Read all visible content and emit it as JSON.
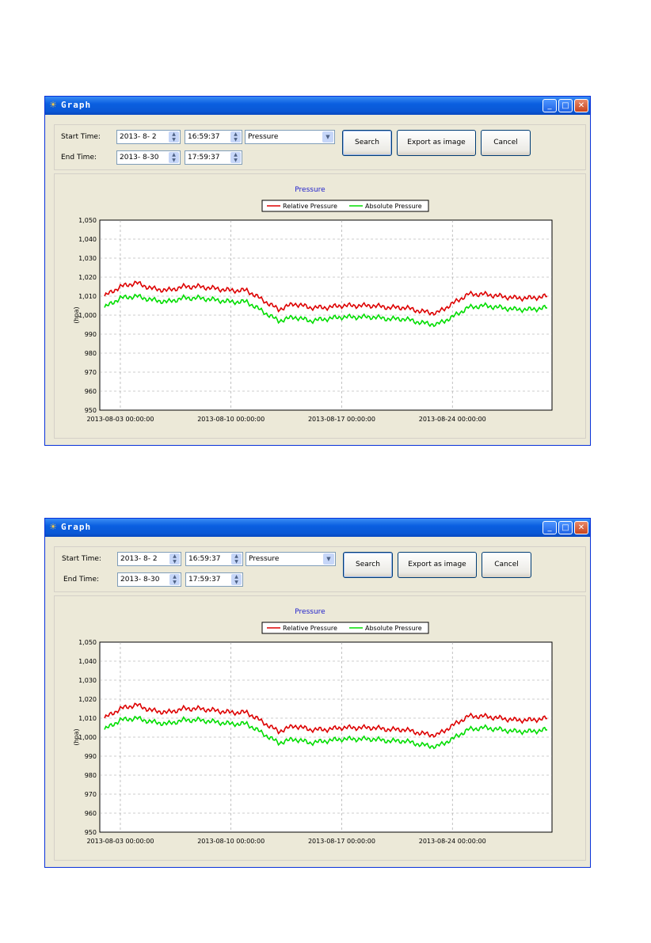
{
  "windows": [
    {
      "title": "Graph",
      "start_label": "Start Time:",
      "end_label": "End Time:",
      "start_date": "2013- 8- 2",
      "start_time": "16:59:37",
      "end_date": "2013- 8-30",
      "end_time": "17:59:37",
      "type_selected": "Pressure",
      "search_label": "Search",
      "export_label": "Export as image",
      "cancel_label": "Cancel"
    },
    {
      "title": "Graph",
      "start_label": "Start Time:",
      "end_label": "End Time:",
      "start_date": "2013- 8- 2",
      "start_time": "16:59:37",
      "end_date": "2013- 8-30",
      "end_time": "17:59:37",
      "type_selected": "Pressure",
      "search_label": "Search",
      "export_label": "Export as image",
      "cancel_label": "Cancel"
    }
  ],
  "colors": {
    "relative": "#dd0000",
    "absolute": "#00dd00",
    "title_text": "#2222cc"
  },
  "chart_data": [
    {
      "type": "line",
      "title": "Pressure",
      "ylabel": "(hpa)",
      "ylim": [
        950,
        1050
      ],
      "yticks": [
        "950",
        "960",
        "970",
        "980",
        "990",
        "1,000",
        "1,010",
        "1,020",
        "1,030",
        "1,040",
        "1,050"
      ],
      "x_tick_labels": [
        "2013-08-03 00:00:00",
        "2013-08-10 00:00:00",
        "2013-08-17 00:00:00",
        "2013-08-24 00:00:00"
      ],
      "x_days": [
        0,
        1,
        2,
        3,
        4,
        5,
        6,
        7,
        8,
        9,
        10,
        11,
        12,
        13,
        14,
        15,
        16,
        17,
        18,
        19,
        20,
        21,
        22,
        23,
        24,
        25,
        26,
        27,
        28
      ],
      "x_start": "2013-08-02",
      "grid": true,
      "legend_position": "top",
      "series": [
        {
          "name": "Relative Pressure",
          "values": [
            1010,
            1015,
            1017,
            1014,
            1013,
            1015,
            1015,
            1014,
            1013,
            1013,
            1008,
            1003,
            1006,
            1004,
            1004,
            1005,
            1005,
            1005,
            1004,
            1004,
            1002,
            1001,
            1006,
            1011,
            1011,
            1010,
            1009,
            1009,
            1010
          ]
        },
        {
          "name": "Absolute Pressure",
          "values": [
            1004,
            1009,
            1010,
            1008,
            1007,
            1009,
            1009,
            1008,
            1007,
            1007,
            1002,
            997,
            999,
            997,
            998,
            999,
            999,
            999,
            998,
            998,
            996,
            995,
            999,
            1004,
            1005,
            1004,
            1003,
            1003,
            1004
          ]
        }
      ]
    },
    {
      "type": "line",
      "title": "Pressure",
      "ylabel": "(hpa)",
      "ylim": [
        950,
        1050
      ],
      "yticks": [
        "950",
        "960",
        "970",
        "980",
        "990",
        "1,000",
        "1,010",
        "1,020",
        "1,030",
        "1,040",
        "1,050"
      ],
      "x_tick_labels": [
        "2013-08-03 00:00:00",
        "2013-08-10 00:00:00",
        "2013-08-17 00:00:00",
        "2013-08-24 00:00:00"
      ],
      "x_days": [
        0,
        1,
        2,
        3,
        4,
        5,
        6,
        7,
        8,
        9,
        10,
        11,
        12,
        13,
        14,
        15,
        16,
        17,
        18,
        19,
        20,
        21,
        22,
        23,
        24,
        25,
        26,
        27,
        28
      ],
      "x_start": "2013-08-02",
      "grid": true,
      "legend_position": "top",
      "series": [
        {
          "name": "Relative Pressure",
          "values": [
            1010,
            1015,
            1017,
            1014,
            1013,
            1015,
            1015,
            1014,
            1013,
            1013,
            1008,
            1003,
            1006,
            1004,
            1004,
            1005,
            1005,
            1005,
            1004,
            1004,
            1002,
            1001,
            1006,
            1011,
            1011,
            1010,
            1009,
            1009,
            1010
          ]
        },
        {
          "name": "Absolute Pressure",
          "values": [
            1004,
            1009,
            1010,
            1008,
            1007,
            1009,
            1009,
            1008,
            1007,
            1007,
            1002,
            997,
            999,
            997,
            998,
            999,
            999,
            999,
            998,
            998,
            996,
            995,
            999,
            1004,
            1005,
            1004,
            1003,
            1003,
            1004
          ]
        }
      ]
    }
  ]
}
